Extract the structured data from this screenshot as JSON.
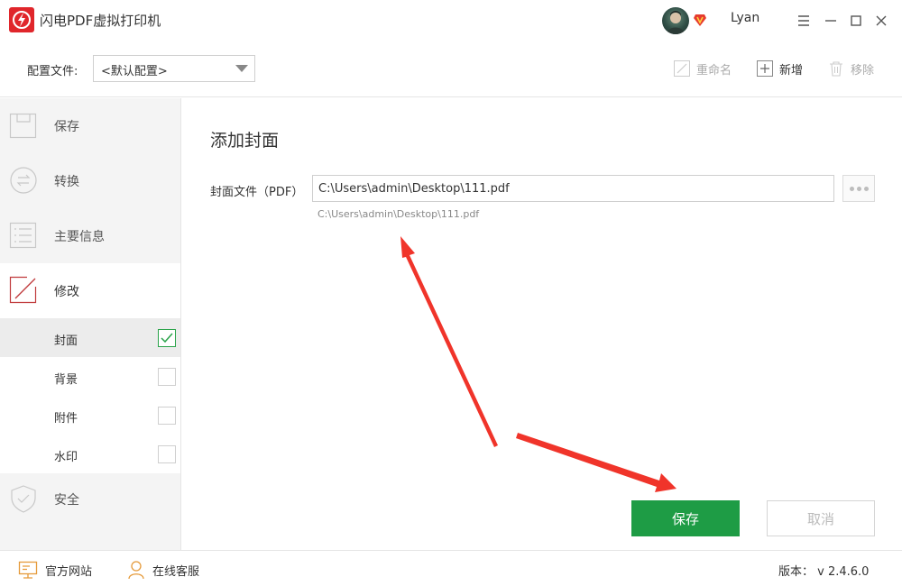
{
  "app": {
    "title": "闪电PDF虚拟打印机"
  },
  "user": {
    "name": "Lyan"
  },
  "config": {
    "label": "配置文件:",
    "selected": "<默认配置>",
    "rename": "重命名",
    "add": "新增",
    "remove": "移除"
  },
  "sidebar": {
    "items": [
      {
        "label": "保存"
      },
      {
        "label": "转换"
      },
      {
        "label": "主要信息"
      },
      {
        "label": "修改"
      },
      {
        "label": "安全"
      }
    ],
    "sub_items": [
      {
        "label": "封面",
        "checked": true
      },
      {
        "label": "背景",
        "checked": false
      },
      {
        "label": "附件",
        "checked": false
      },
      {
        "label": "水印",
        "checked": false
      }
    ]
  },
  "main": {
    "title": "添加封面",
    "field_label": "封面文件（PDF）",
    "file_path": "C:\\Users\\admin\\Desktop\\111.pdf",
    "path_hint": "C:\\Users\\admin\\Desktop\\111.pdf",
    "save_label": "保存",
    "cancel_label": "取消"
  },
  "status": {
    "website": "官方网站",
    "support": "在线客服",
    "version": "版本： v 2.4.6.0"
  },
  "colors": {
    "accent_green": "#1e9c45",
    "brand_red": "#e0262b",
    "annotation_red": "#f0342a"
  }
}
